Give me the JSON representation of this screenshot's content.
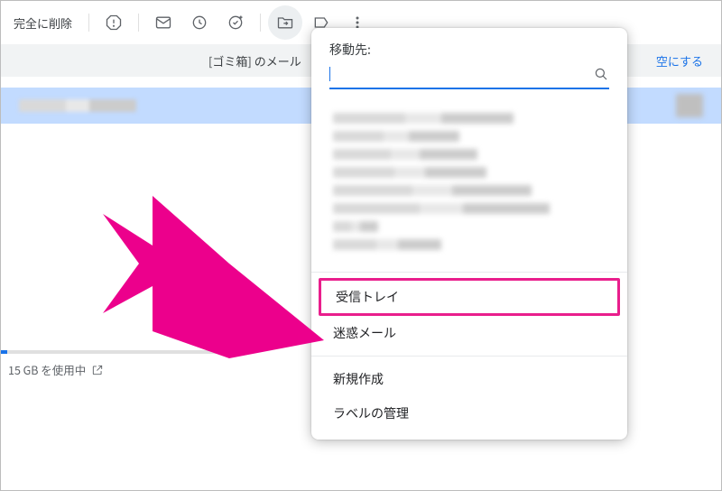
{
  "toolbar": {
    "delete_forever": "完全に削除"
  },
  "notice": {
    "message_prefix": "[ゴミ箱] のメール",
    "empty_link": "空にする"
  },
  "storage": {
    "used_text": "15 GB を使用中"
  },
  "popup": {
    "title": "移動先:",
    "search_placeholder": "",
    "items": {
      "inbox": "受信トレイ",
      "spam": "迷惑メール",
      "create_new": "新規作成",
      "manage_labels": "ラベルの管理"
    }
  },
  "colors": {
    "accent": "#1a73e8",
    "annotation": "#ec008c"
  }
}
